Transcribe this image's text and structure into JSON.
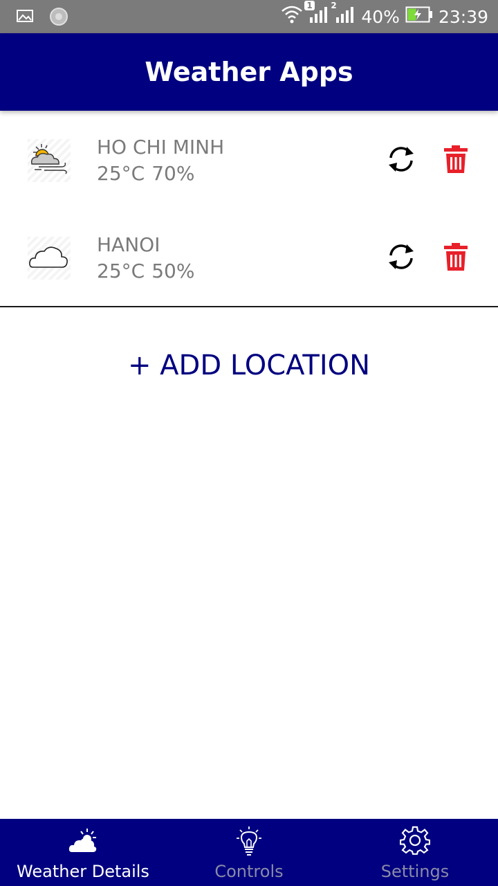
{
  "status_bar": {
    "battery_percent": "40%",
    "time": "23:39",
    "sim1_label": "1",
    "sim2_label": "2"
  },
  "app_bar": {
    "title": "Weather Apps"
  },
  "locations": [
    {
      "name": "HO CHI MINH",
      "temperature": "25°C",
      "humidity": "70%",
      "icon": "sun-cloud-wind-icon"
    },
    {
      "name": "HANOI",
      "temperature": "25°C",
      "humidity": "50%",
      "icon": "cloud-icon"
    }
  ],
  "add_location_label": "+ ADD LOCATION",
  "bottom_nav": {
    "items": [
      {
        "label": "Weather Details",
        "icon": "cloud-sun-icon",
        "active": true
      },
      {
        "label": "Controls",
        "icon": "lightbulb-icon",
        "active": false
      },
      {
        "label": "Settings",
        "icon": "gear-icon",
        "active": false
      }
    ]
  },
  "colors": {
    "primary": "#000080",
    "status_bar": "#7b7b7b",
    "delete": "#e8202a",
    "text_secondary": "#7a7a7a"
  }
}
